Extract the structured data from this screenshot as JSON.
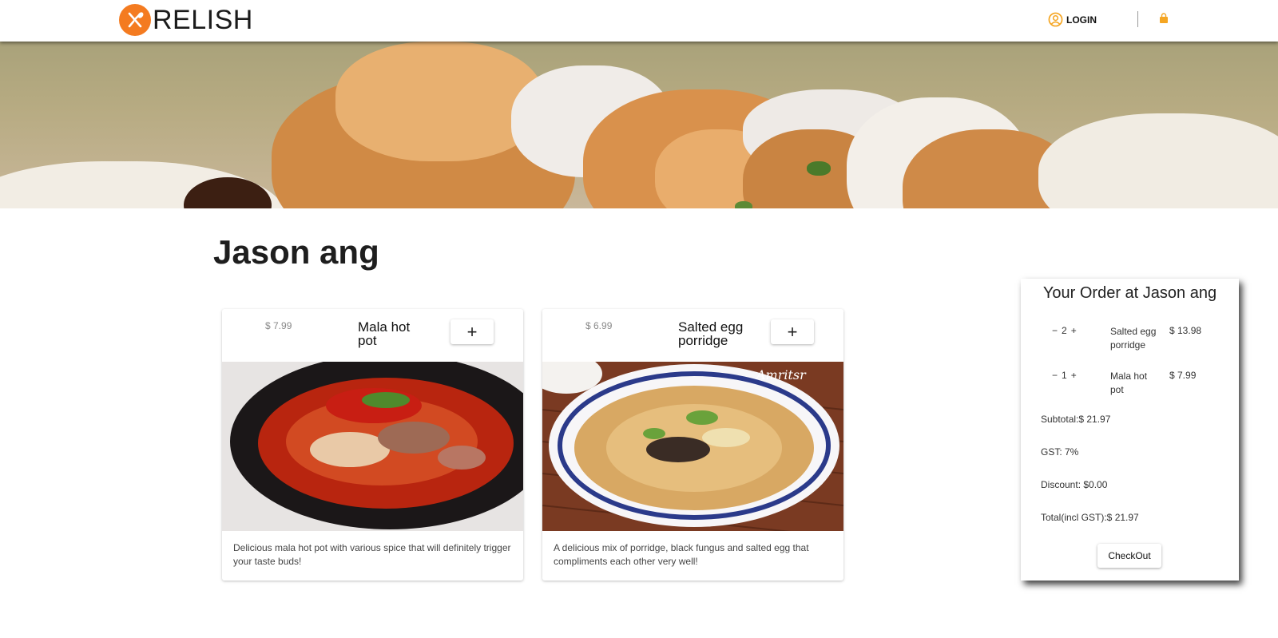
{
  "header": {
    "brand": "RELISH",
    "login_label": "LOGIN",
    "icons": [
      "fork-knife-icon",
      "user-circle-icon",
      "shopping-bag-icon"
    ]
  },
  "restaurant": {
    "name": "Jason ang"
  },
  "menu": [
    {
      "price": "$ 7.99",
      "name": "Mala hot pot",
      "add_label": "+",
      "description": "Delicious mala hot pot with various spice that will definitely trigger your taste buds!"
    },
    {
      "price": "$ 6.99",
      "name": "Salted egg porridge",
      "add_label": "+",
      "description": "A delicious mix of porridge, black fungus and salted egg that compliments each other very well!"
    }
  ],
  "order": {
    "title": "Your Order at Jason ang",
    "items": [
      {
        "minus": "−",
        "qty": "2",
        "plus": "+",
        "name": "Salted egg porridge",
        "price": "$ 13.98"
      },
      {
        "minus": "−",
        "qty": "1",
        "plus": "+",
        "name": "Mala hot pot",
        "price": "$ 7.99"
      }
    ],
    "subtotal": "Subtotal:$ 21.97",
    "gst": "GST: 7%",
    "discount": "Discount: $0.00",
    "total": "Total(incl GST):$ 21.97",
    "checkout_label": "CheckOut"
  },
  "colors": {
    "brand_orange": "#f47b20",
    "bag_orange": "#f5a623"
  }
}
